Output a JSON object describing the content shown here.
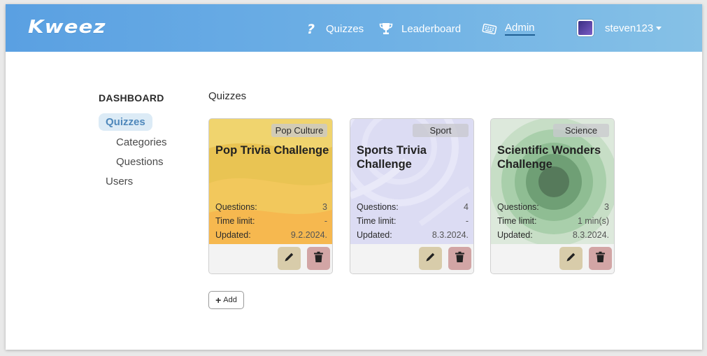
{
  "app": {
    "logo": "Kweez"
  },
  "nav": {
    "items": [
      {
        "label": "Quizzes",
        "icon": "question-icon"
      },
      {
        "label": "Leaderboard",
        "icon": "trophy-icon"
      },
      {
        "label": "Admin",
        "icon": "keyboard-icon",
        "active": true
      }
    ],
    "user": {
      "name": "steven123"
    }
  },
  "sidebar": {
    "title": "DASHBOARD",
    "items": [
      {
        "label": "Quizzes",
        "active": true
      },
      {
        "label": "Categories"
      },
      {
        "label": "Questions"
      },
      {
        "label": "Users"
      }
    ]
  },
  "main": {
    "title": "Quizzes",
    "stat_labels": {
      "questions": "Questions:",
      "time_limit": "Time limit:",
      "updated": "Updated:"
    },
    "cards": [
      {
        "category": "Pop Culture",
        "title": "Pop Trivia Challenge",
        "questions": "3",
        "time_limit": "-",
        "updated": "9.2.2024.",
        "theme": "#f5c04f"
      },
      {
        "category": "Sport",
        "title": "Sports Trivia Challenge",
        "questions": "4",
        "time_limit": "-",
        "updated": "8.3.2024.",
        "theme": "#dcdcf3"
      },
      {
        "category": "Science",
        "title": "Scientific Wonders Challenge",
        "questions": "3",
        "time_limit": "1 min(s)",
        "updated": "8.3.2024.",
        "theme": "#9cc8a4"
      }
    ],
    "add_label": "Add"
  },
  "colors": {
    "nav_start": "#5aa0e2",
    "nav_end": "#86c1e6",
    "sidebar_active_bg": "#dcebf6",
    "sidebar_active_text": "#4f88bb",
    "edit_button": "#d8ccaa",
    "delete_button": "#d2a5a5"
  }
}
